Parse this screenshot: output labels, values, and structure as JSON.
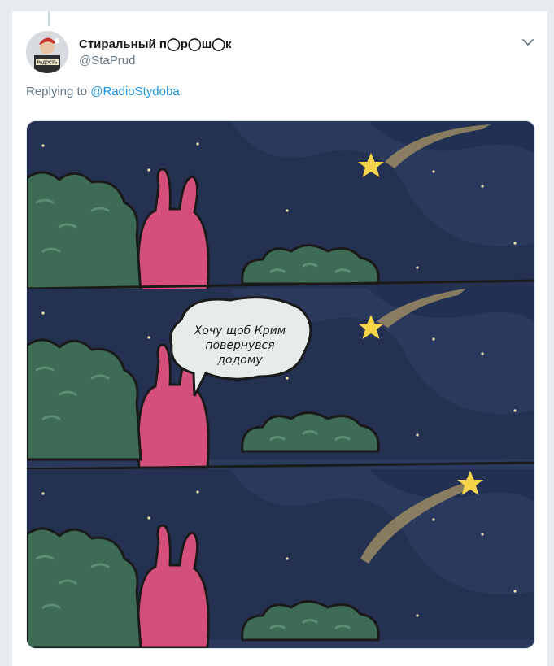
{
  "tweet": {
    "display_name": "Стиральный п◯р◯ш◯к",
    "handle": "@StaPrud",
    "replying_prefix": "Replying to",
    "replying_to": "@RadioStydoba",
    "avatar_sign_text": "РАДОСТЬ"
  },
  "comic": {
    "panels": 3,
    "speech_bubble_lines": [
      "Хочу щоб Крим",
      "повернувся",
      "додому"
    ]
  },
  "icons": {
    "caret": "chevron-down-icon"
  },
  "colors": {
    "name": "#14171a",
    "secondary": "#657786",
    "link": "#1b95e0",
    "sky": "#2b3a5c",
    "sky_dark": "#1f2a47",
    "bush": "#3e6b55",
    "rabbit": "#d4507a",
    "star": "#f7d54a"
  }
}
